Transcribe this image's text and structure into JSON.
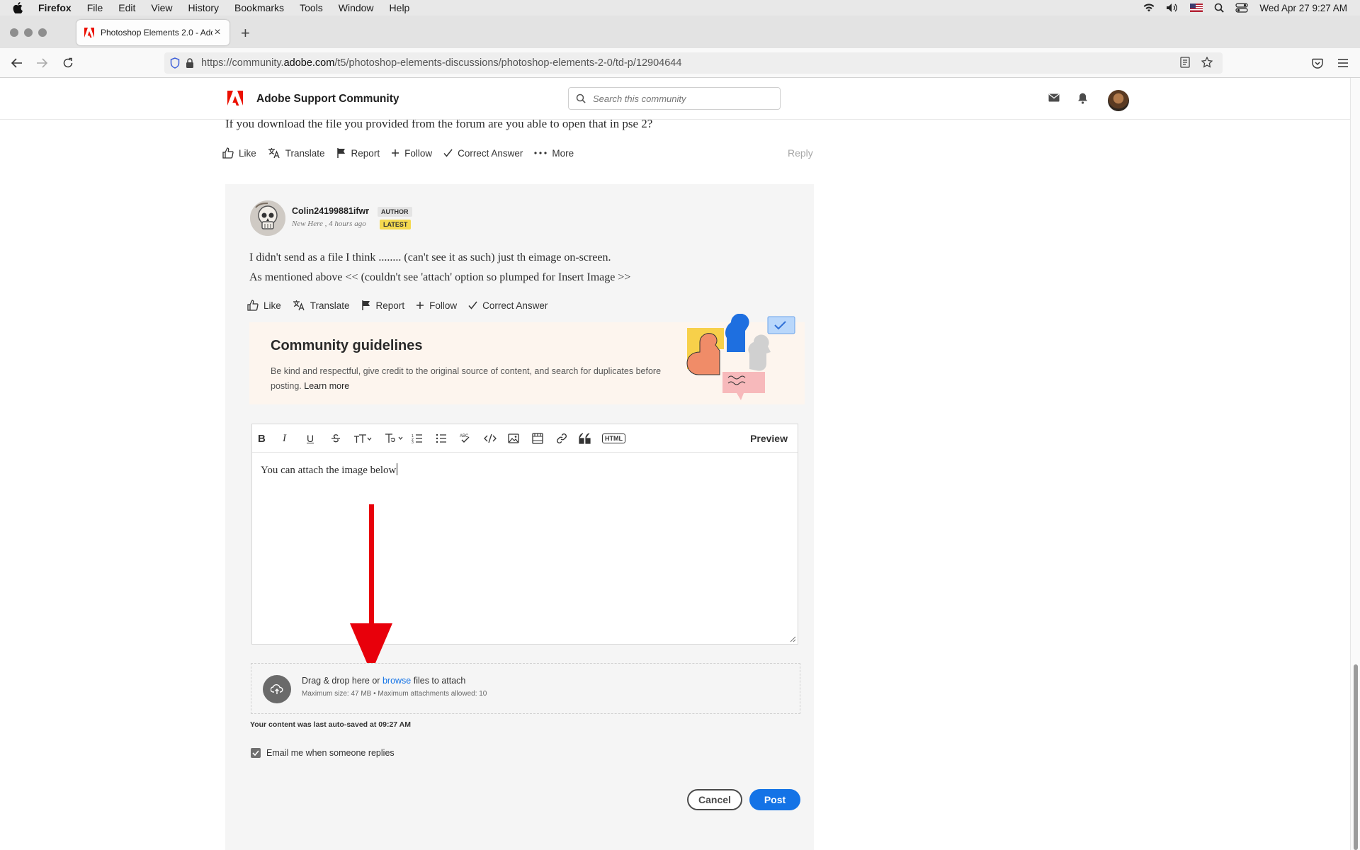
{
  "menubar": {
    "app": "Firefox",
    "items": [
      "File",
      "Edit",
      "View",
      "History",
      "Bookmarks",
      "Tools",
      "Window",
      "Help"
    ],
    "datetime": "Wed Apr 27  9:27 AM"
  },
  "tab": {
    "title": "Photoshop Elements 2.0 - Adob",
    "close": "×"
  },
  "newtab": "+",
  "url": {
    "prefix": "https://community.",
    "domain": "adobe.com",
    "path": "/t5/photoshop-elements-discussions/photoshop-elements-2-0/td-p/12904644"
  },
  "site": {
    "brand": "Adobe Support Community",
    "search_placeholder": "Search this community"
  },
  "prev_post": {
    "text": "If you download the file you provided from the forum are you able to open that in pse 2?",
    "actions": {
      "like": "Like",
      "translate": "Translate",
      "report": "Report",
      "follow": "Follow",
      "correct": "Correct Answer",
      "more": "More"
    },
    "reply": "Reply"
  },
  "post": {
    "username": "Colin24199881ifwr",
    "author_badge": "AUTHOR",
    "meta": "New Here , 4 hours ago",
    "latest_badge": "LATEST",
    "line1": "I didn't send as a file I think ........ (can't see it as such) just th eimage on-screen.",
    "line2": "As mentioned above << (couldn't see 'attach' option so plumped for Insert Image >>",
    "actions": {
      "like": "Like",
      "translate": "Translate",
      "report": "Report",
      "follow": "Follow",
      "correct": "Correct Answer"
    }
  },
  "guidelines": {
    "title": "Community guidelines",
    "text": "Be kind and respectful, give credit to the original source of content, and search for duplicates before posting.",
    "link": "Learn more"
  },
  "editor": {
    "preview": "Preview",
    "html_label": "HTML",
    "content": "You can attach the image below"
  },
  "attach": {
    "line1_pre": "Drag & drop here or ",
    "browse": "browse",
    "line1_post": " files to attach",
    "line2": "Maximum size: 47 MB • Maximum attachments allowed: 10"
  },
  "autosave": "Your content was last auto-saved at 09:27 AM",
  "email_label": "Email me when someone replies",
  "buttons": {
    "cancel": "Cancel",
    "post": "Post"
  },
  "colors": {
    "accent": "#1473e6",
    "adobe_red": "#eb1000",
    "annotation_arrow": "#e8000b"
  }
}
